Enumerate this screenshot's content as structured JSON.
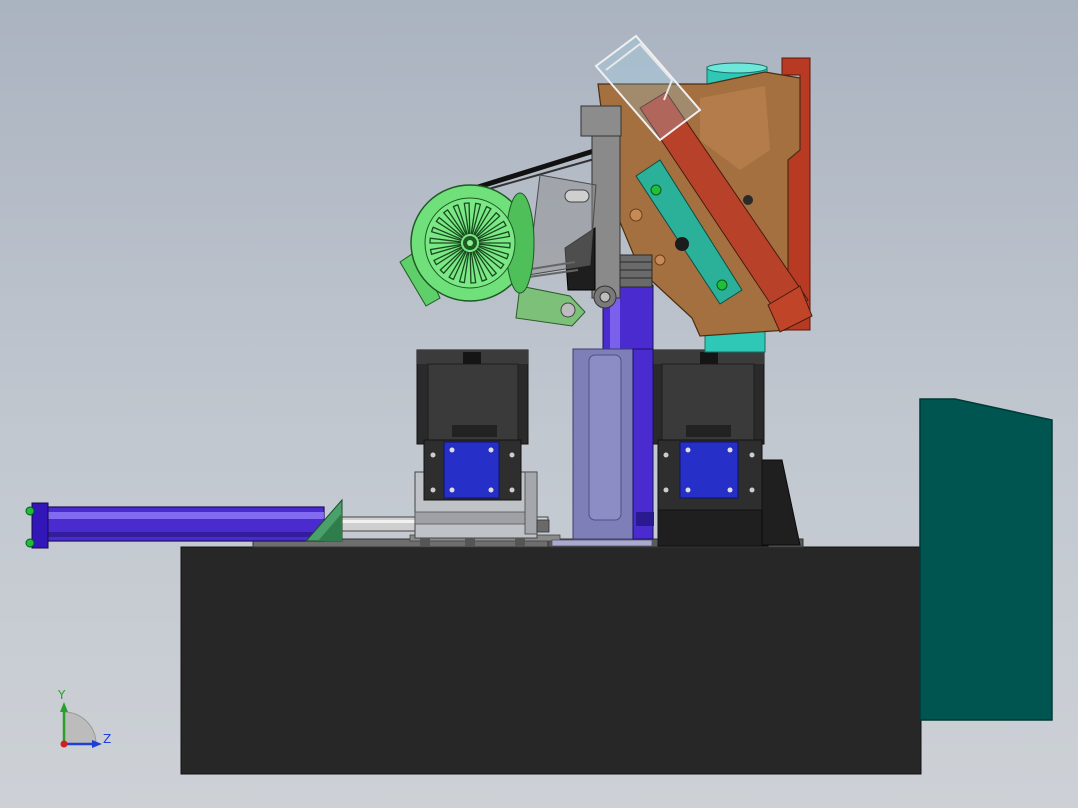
{
  "triad": {
    "y_label": "Y",
    "z_label": "Z",
    "y_color": "#2aa02a",
    "z_color": "#1f3fd6",
    "origin_color": "#d02020"
  },
  "colors": {
    "bed": "#272727",
    "cabinet": "#005550",
    "motor_green": "#6fe07a",
    "brown_body": "#a57040",
    "red_plate": "#b83a22",
    "teal_plate": "#2bb19a",
    "cylinder_blue": "#4a2bd0",
    "cylinder_lavender": "#7e7fb8",
    "steel_gray": "#9a9a9a",
    "blue_block": "#2630c8"
  },
  "components": [
    "machine-bed",
    "control-cabinet",
    "horizontal-cylinder",
    "left-slide-unit",
    "right-slide-unit",
    "vertical-cylinder",
    "teal-column",
    "grinder-head",
    "drive-motor"
  ]
}
